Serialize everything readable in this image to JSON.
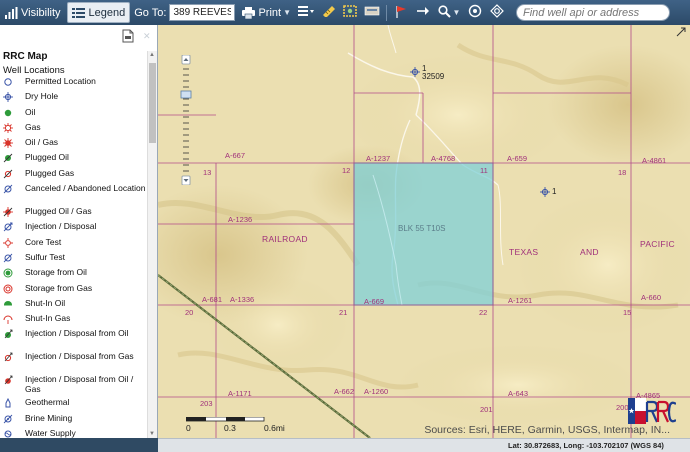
{
  "toolbar": {
    "visibility_label": "Visibility",
    "legend_label": "Legend",
    "goto_label": "Go To:",
    "goto_value": "389 REEVES",
    "print_label": "Print",
    "search_placeholder": "Find well api or address",
    "accent": "#2c4a68"
  },
  "panel": {
    "title": "RRC Map",
    "subtitle": "Well Locations",
    "items": [
      {
        "label": "Permitted Location",
        "icon": "permitted-location-icon"
      },
      {
        "label": "Dry Hole",
        "icon": "dry-hole-icon"
      },
      {
        "label": "Oil",
        "icon": "oil-icon"
      },
      {
        "label": "Gas",
        "icon": "gas-icon"
      },
      {
        "label": "Oil / Gas",
        "icon": "oil-gas-icon"
      },
      {
        "label": "Plugged Oil",
        "icon": "plugged-oil-icon"
      },
      {
        "label": "Plugged Gas",
        "icon": "plugged-gas-icon"
      },
      {
        "label": "Canceled / Abandoned Location",
        "icon": "canceled-location-icon"
      },
      {
        "label": "Plugged Oil / Gas",
        "icon": "plugged-oil-gas-icon"
      },
      {
        "label": "Injection / Disposal",
        "icon": "injection-icon"
      },
      {
        "label": "Core Test",
        "icon": "core-test-icon"
      },
      {
        "label": "Sulfur Test",
        "icon": "sulfur-test-icon"
      },
      {
        "label": "Storage from Oil",
        "icon": "storage-oil-icon"
      },
      {
        "label": "Storage from Gas",
        "icon": "storage-gas-icon"
      },
      {
        "label": "Shut-In Oil",
        "icon": "shut-in-oil-icon"
      },
      {
        "label": "Shut-In Gas",
        "icon": "shut-in-gas-icon"
      },
      {
        "label": "Injection / Disposal from Oil",
        "icon": "injection-oil-icon"
      },
      {
        "label": "Injection / Disposal from Gas",
        "icon": "injection-gas-icon"
      },
      {
        "label": "Injection / Disposal from Oil / Gas",
        "icon": "injection-oil-gas-icon"
      },
      {
        "label": "Geothermal",
        "icon": "geothermal-icon"
      },
      {
        "label": "Brine Mining",
        "icon": "brine-mining-icon"
      },
      {
        "label": "Water Supply",
        "icon": "water-supply-icon"
      }
    ]
  },
  "map": {
    "section_labels": [
      "13",
      "12",
      "11",
      "18",
      "20",
      "21",
      "22",
      "15",
      "203",
      "201",
      "200"
    ],
    "abstract_labels": [
      "A-667",
      "A-1237",
      "A-4768",
      "A-659",
      "A-4861",
      "A-1236",
      "A-681",
      "A-1336",
      "A-669",
      "A-1261",
      "A-660",
      "A-1171",
      "A-662",
      "A-1260",
      "A-643",
      "A-4865"
    ],
    "block_label": "BLK 55 T10S",
    "railroad_words": [
      "RAILROAD",
      "TEXAS",
      "AND",
      "PACIFIC"
    ],
    "wells": [
      {
        "line1": "1",
        "line2": "32509"
      },
      {
        "line1": "1",
        "line2": ""
      }
    ],
    "scale": {
      "t0": "0",
      "t1": "0.3",
      "t2": "0.6mi"
    },
    "sources": "Sources: Esri, HERE, Garmin, USGS, Intermap, IN...",
    "selected_color": "#7fd0d8"
  },
  "status": {
    "coords": "Lat: 30.872683, Long: -103.702107 (WGS 84)"
  }
}
